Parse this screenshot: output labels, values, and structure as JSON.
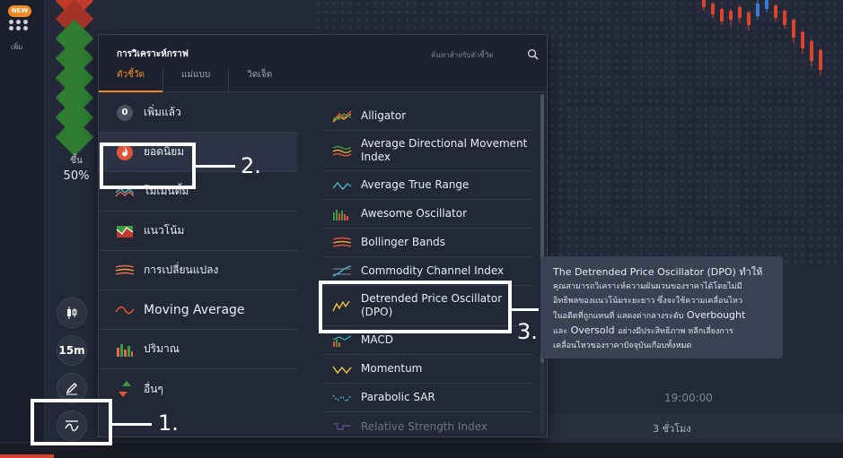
{
  "leftbar": {
    "new_badge": "NEW",
    "menu_icon": "grid-dots-icon",
    "add_label": "เพิ่ม"
  },
  "sentiment": {
    "label": "ขึ้น",
    "percent": "50%"
  },
  "tools": {
    "candles_icon": "candlestick-icon",
    "timeframe": "15m",
    "draw_icon": "pencil-icon",
    "indicators_icon": "indicator-wave-icon"
  },
  "panel": {
    "title": "การวิเคราะห์กราฟ",
    "search_placeholder": "ค้นหาสำหรับตัวชี้วัด",
    "tabs": [
      {
        "label": "ตัวชี้วัด",
        "active": true
      },
      {
        "label": "แม่แบบ",
        "active": false
      },
      {
        "label": "วิดเจ็ต",
        "active": false
      }
    ],
    "categories": [
      {
        "label": "เพิ่มแล้ว",
        "count": "0",
        "icon": "count-badge-icon"
      },
      {
        "label": "ยอดนิยม",
        "icon": "fire-icon",
        "active": true
      },
      {
        "label": "โมเมนตั้ม",
        "icon": "momentum-lines-icon"
      },
      {
        "label": "แนวโน้ม",
        "icon": "trend-chart-icon"
      },
      {
        "label": "การเปลี่ยนแปลง",
        "icon": "volatility-waves-icon"
      },
      {
        "label": "Moving Average",
        "icon": "moving-average-icon"
      },
      {
        "label": "ปริมาณ",
        "icon": "volume-bars-icon"
      },
      {
        "label": "อื่นๆ",
        "icon": "up-down-arrows-icon"
      }
    ],
    "indicators": [
      {
        "label": "Alligator",
        "icon": "alligator-icon"
      },
      {
        "label": "Average Directional Movement Index",
        "icon": "adx-icon"
      },
      {
        "label": "Average True Range",
        "icon": "atr-icon"
      },
      {
        "label": "Awesome Oscillator",
        "icon": "awesome-oscillator-icon"
      },
      {
        "label": "Bollinger Bands",
        "icon": "bollinger-icon"
      },
      {
        "label": "Commodity Channel Index",
        "icon": "cci-icon"
      },
      {
        "label": "Detrended Price Oscillator (DPO)",
        "icon": "dpo-icon"
      },
      {
        "label": "MACD",
        "icon": "macd-icon"
      },
      {
        "label": "Momentum",
        "icon": "momentum-icon"
      },
      {
        "label": "Parabolic SAR",
        "icon": "parabolic-sar-icon"
      },
      {
        "label": "Relative Strength Index",
        "icon": "rsi-icon"
      }
    ]
  },
  "tooltip": {
    "line1": "The Detrended Price Oscillator (DPO) ทำให้",
    "line2": "คุณสามารถวิเคราะห์ความผันผวนของราคาได้โดยไม่มี",
    "line3": "อิทธิพลของแนวโน้มระยะยาว ซึ่งจะใช้ความเคลื่อนไหว",
    "line4a": "ในอดีตที่ถูกแทนที่ แสดงค่ากลางระดับ",
    "line4b": "Overbought",
    "line5a": "และ",
    "line5b": "Oversold",
    "line5c": "อย่างมีประสิทธิภาพ หลีกเลี่ยงการ",
    "line6": "เคลื่อนไหวของราคาปัจจุบันเกือบทั้งหมด"
  },
  "chart": {
    "time_label": "19:00:00",
    "timeframe_label": "3 ชั่วโมง"
  },
  "annotations": [
    {
      "label": "1."
    },
    {
      "label": "2."
    },
    {
      "label": "3."
    }
  ],
  "colors": {
    "accent": "#f08a24",
    "green": "#3d9a3d",
    "red": "#d9442f"
  }
}
